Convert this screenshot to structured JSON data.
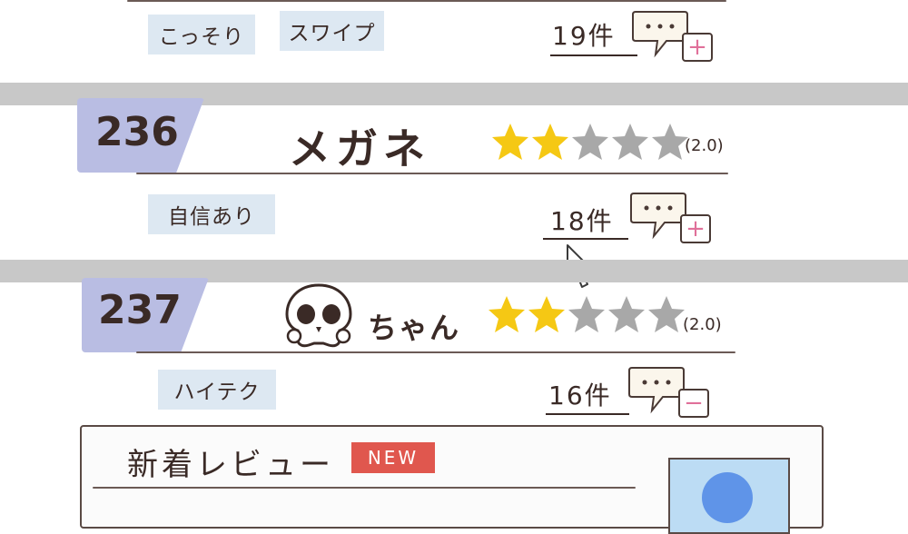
{
  "top_row": {
    "tags": [
      "こっそり",
      "スワイプ"
    ],
    "count": "19件",
    "comment_action": "+"
  },
  "entries": [
    {
      "rank": "236",
      "name": "メガネ",
      "stars_filled": 2,
      "stars_total": 5,
      "rating": "(2.0)",
      "tag": "自信あり",
      "count": "18件",
      "comment_action": "+"
    },
    {
      "rank": "237",
      "name": "ちゃん",
      "icon": "skull-icon",
      "stars_filled": 2,
      "stars_total": 5,
      "rating": "(2.0)",
      "tag": "ハイテク",
      "count": "16件",
      "comment_action": "−"
    }
  ],
  "new_reviews": {
    "title": "新着レビュー",
    "badge": "NEW"
  },
  "colors": {
    "rank_badge": "#b9bde3",
    "tag_bg": "#dde8f2",
    "star_filled": "#f5c814",
    "star_empty": "#a8a8a8",
    "separator": "#c8c8c8",
    "new_badge": "#e0574e",
    "plus_color": "#e0709a"
  }
}
